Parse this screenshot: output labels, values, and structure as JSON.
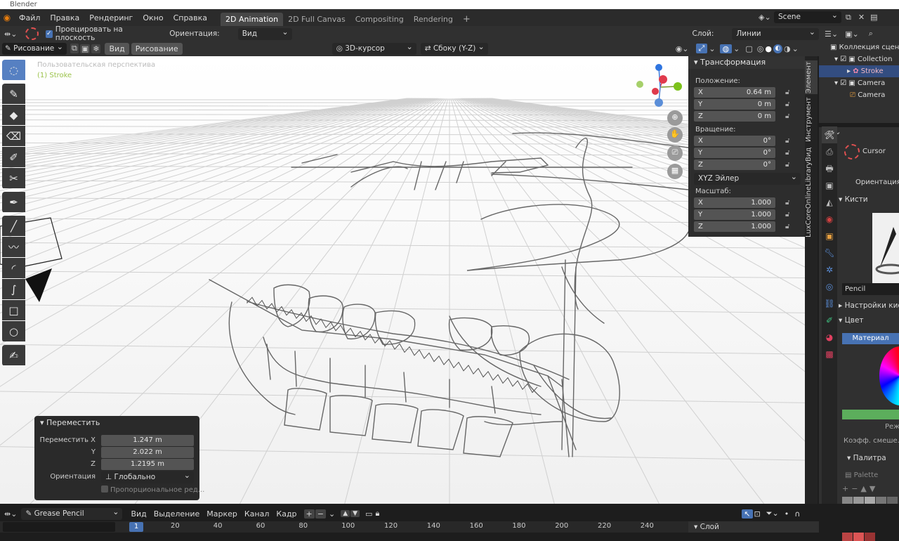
{
  "app_title": "Blender",
  "menu": [
    "Файл",
    "Правка",
    "Рендеринг",
    "Окно",
    "Справка"
  ],
  "workspaces": [
    "2D Animation",
    "2D Full Canvas",
    "Compositing",
    "Rendering"
  ],
  "workspace_add": "+",
  "scene_name": "Scene",
  "header": {
    "project_checkbox_label": "Проецировать на плоскость",
    "orientation_label": "Ориентация:",
    "orientation_value": "Вид",
    "layer_label": "Слой:",
    "layer_value": "Линии"
  },
  "header2": {
    "mode": "Рисование",
    "view_btn": "Вид",
    "draw_btn": "Рисование",
    "placement": "3D-курсор",
    "view_axis": "Сбоку (Y-Z)"
  },
  "viewport": {
    "perspective_label": "Пользовательская перспектива",
    "object_label": "(1) Stroke"
  },
  "npanel": {
    "title": "Трансформация",
    "location_label": "Положение:",
    "location": [
      {
        "axis": "X",
        "value": "0.64 m"
      },
      {
        "axis": "Y",
        "value": "0 m"
      },
      {
        "axis": "Z",
        "value": "0 m"
      }
    ],
    "rotation_label": "Вращение:",
    "rotation": [
      {
        "axis": "X",
        "value": "0°"
      },
      {
        "axis": "Y",
        "value": "0°"
      },
      {
        "axis": "Z",
        "value": "0°"
      }
    ],
    "rotation_mode": "XYZ Эйлер",
    "scale_label": "Масштаб:",
    "scale": [
      {
        "axis": "X",
        "value": "1.000"
      },
      {
        "axis": "Y",
        "value": "1.000"
      },
      {
        "axis": "Z",
        "value": "1.000"
      }
    ]
  },
  "side_tabs": [
    "Элемент",
    "Инструмент",
    "Вид",
    "LuxCoreOnlineLibrary"
  ],
  "outliner": {
    "root": "Коллекция сцены",
    "items": [
      "Collection",
      "Stroke",
      "Camera",
      "Camera"
    ]
  },
  "properties": {
    "tool_name": "Cursor",
    "orientation_label": "Ориентация",
    "brushes_label": "Кисти",
    "brush_name": "Pencil",
    "brush_settings_label": "Настройки кисти",
    "color_label": "Цвет",
    "material_btn": "Материал",
    "mode_label": "Режим",
    "mix_label": "Коэфф. смеше...",
    "palette_label": "Палитра",
    "palette_name": "Palette"
  },
  "redo_panel": {
    "title": "Переместить",
    "fields": [
      {
        "label": "Переместить X",
        "value": "1.247 m"
      },
      {
        "label": "Y",
        "value": "2.022 m"
      },
      {
        "label": "Z",
        "value": "1.2195 m"
      }
    ],
    "orientation_label": "Ориентация",
    "orientation_value": "Глобально",
    "proportional_label": "Пропорциональное ред..."
  },
  "timeline": {
    "editor": "Grease Pencil",
    "menus": [
      "Вид",
      "Выделение",
      "Маркер",
      "Канал",
      "Кадр"
    ],
    "current_frame": "1",
    "frames": [
      "20",
      "40",
      "60",
      "80",
      "100",
      "120",
      "140",
      "160",
      "180",
      "200",
      "220",
      "240"
    ],
    "layer_panel": "Слой"
  }
}
